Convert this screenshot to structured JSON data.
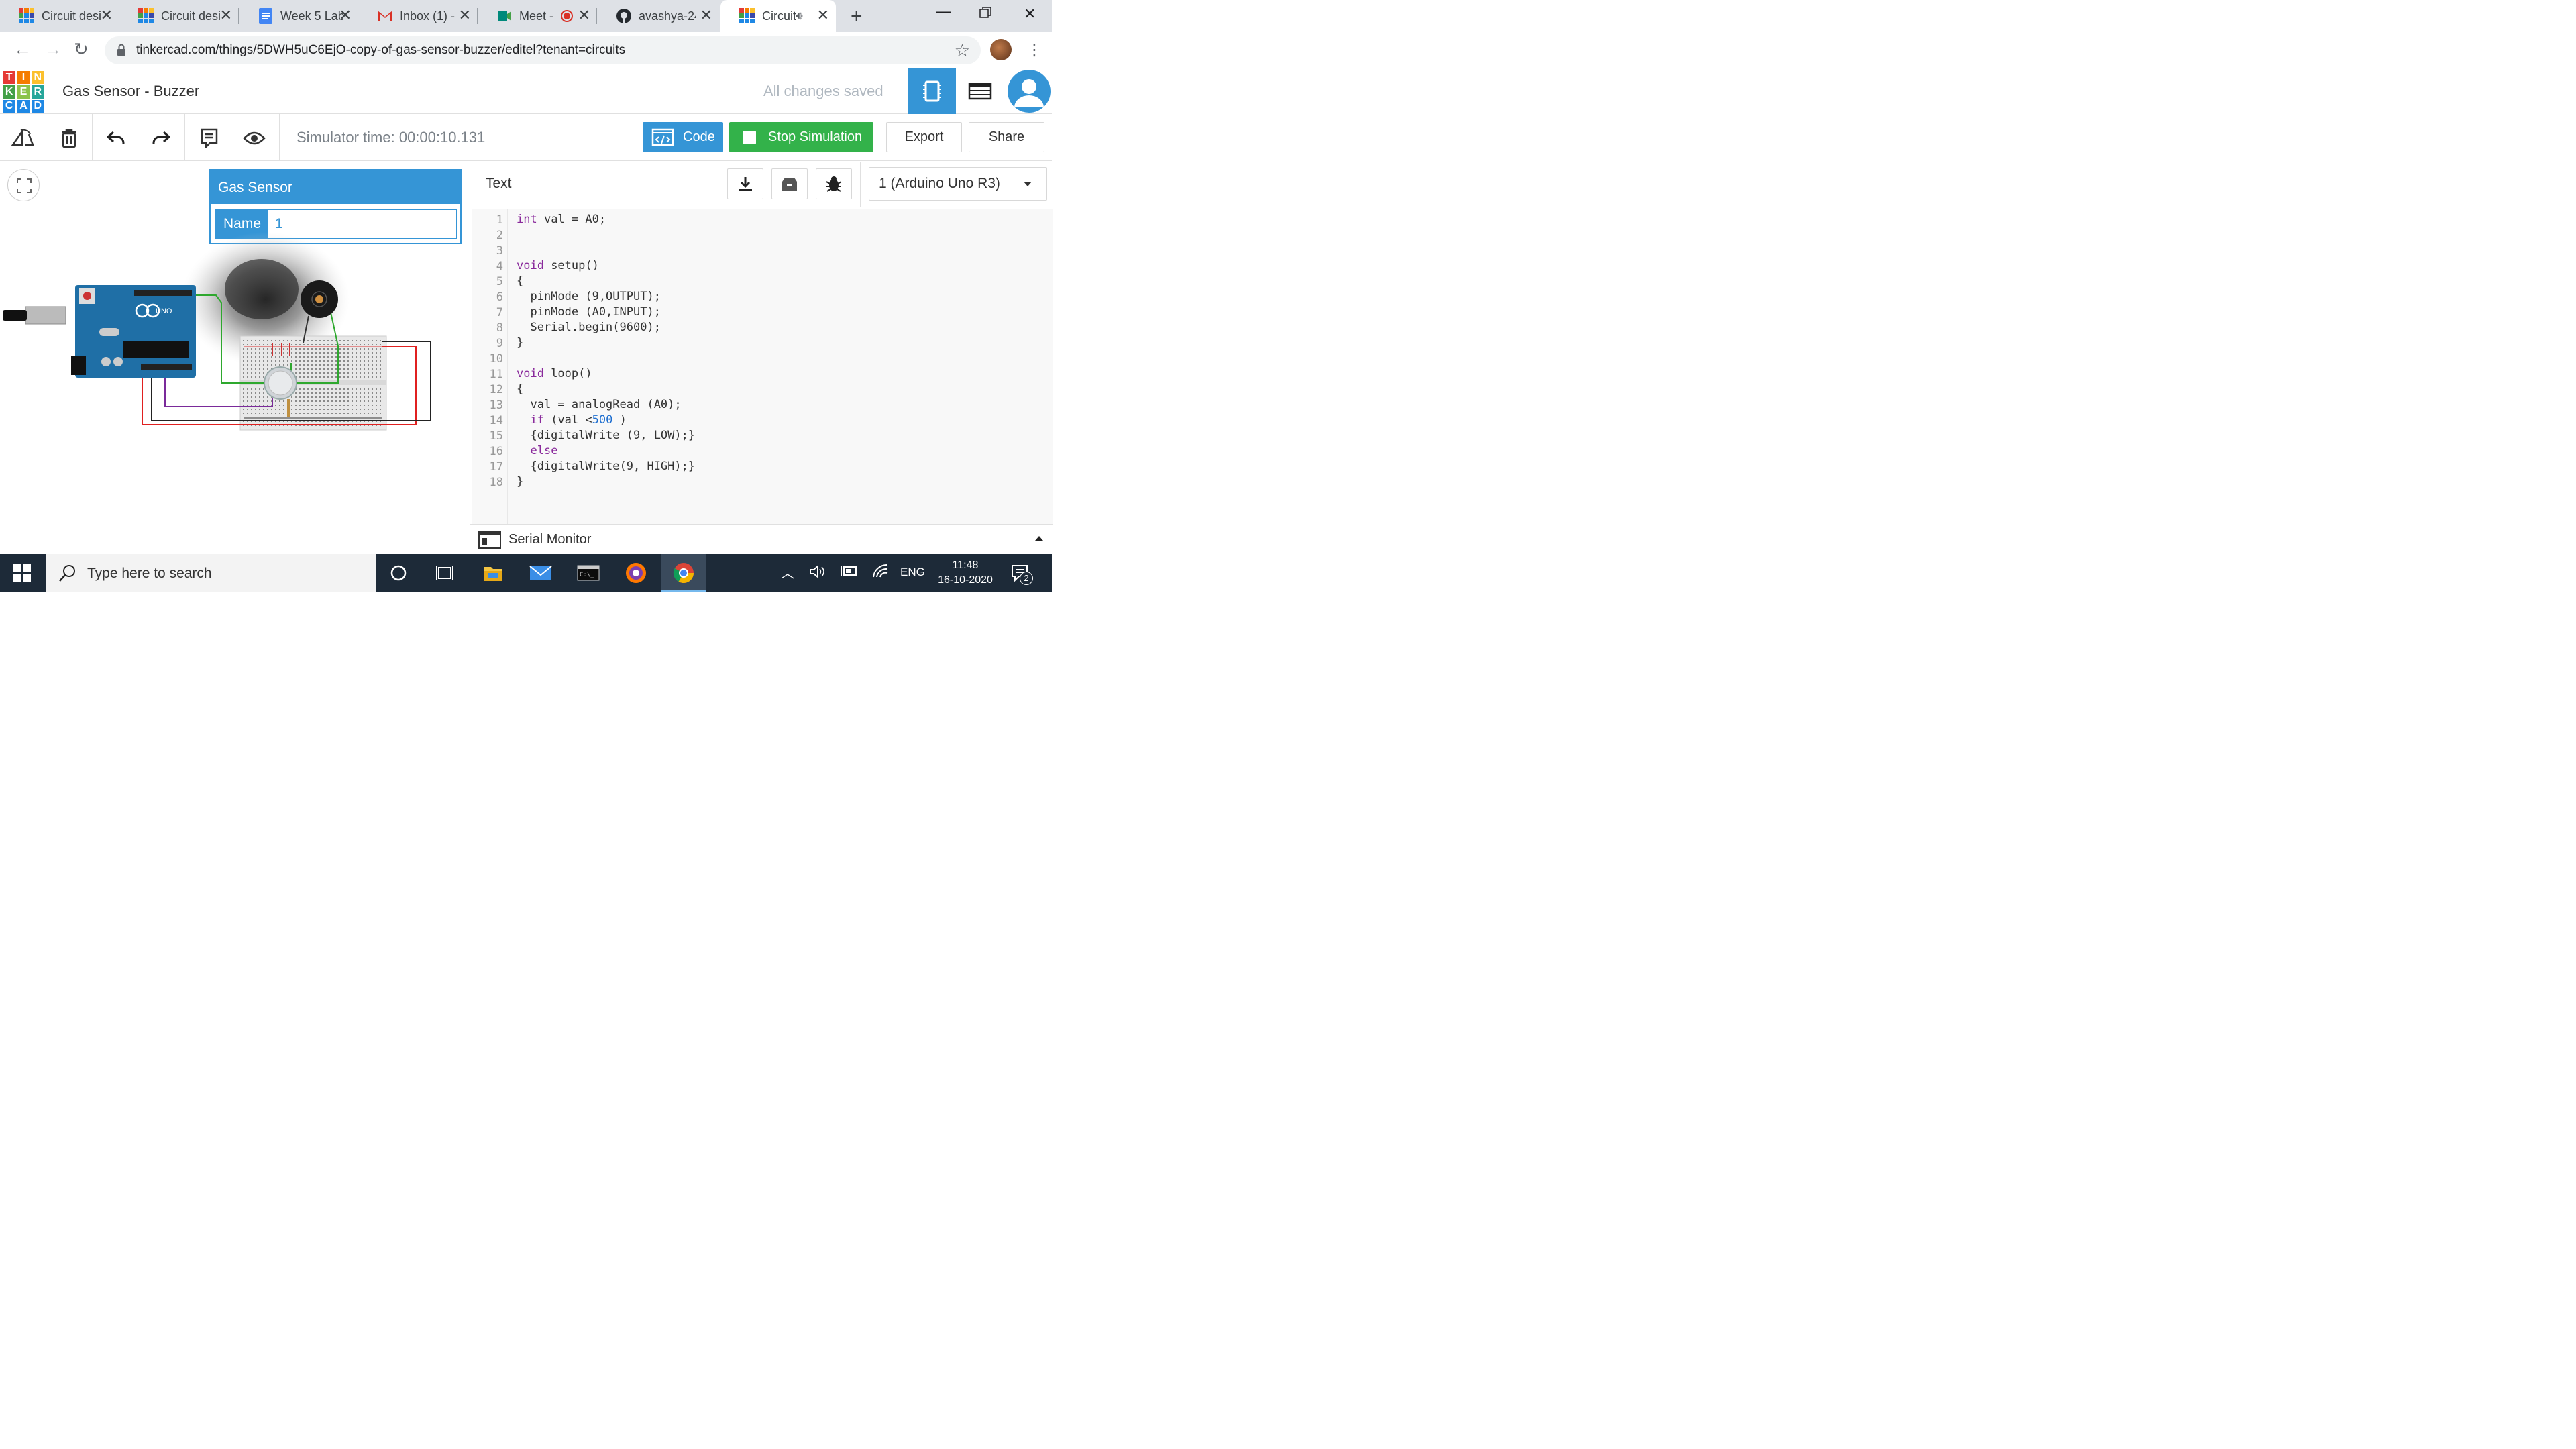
{
  "browser": {
    "tabs": [
      {
        "title": "Circuit desi",
        "icon": "tinkercad-icon"
      },
      {
        "title": "Circuit desi",
        "icon": "tinkercad-icon"
      },
      {
        "title": "Week 5 Lab",
        "icon": "docs-icon"
      },
      {
        "title": "Inbox (1) - ",
        "icon": "gmail-icon"
      },
      {
        "title": "Meet -",
        "icon": "meet-icon"
      },
      {
        "title": "avashya-24",
        "icon": "github-icon"
      },
      {
        "title": "Circuit",
        "icon": "tinkercad-icon"
      }
    ],
    "url": "tinkercad.com/things/5DWH5uC6EjO-copy-of-gas-sensor-buzzer/editel?tenant=circuits"
  },
  "app": {
    "logo_letters": [
      "T",
      "I",
      "N",
      "K",
      "E",
      "R",
      "C",
      "A",
      "D"
    ],
    "project_title": "Gas Sensor - Buzzer",
    "save_status": "All changes saved"
  },
  "toolbar": {
    "sim_time": "Simulator time: 00:00:10.131",
    "code_label": "Code",
    "stop_label": "Stop Simulation",
    "export_label": "Export",
    "share_label": "Share"
  },
  "inspector": {
    "title": "Gas Sensor",
    "name_label": "Name",
    "name_value": "1"
  },
  "code_panel": {
    "mode": "Text",
    "device": "1 (Arduino Uno R3)",
    "serial_monitor": "Serial Monitor",
    "lines": [
      "1",
      "2",
      "3",
      "4",
      "5",
      "6",
      "7",
      "8",
      "9",
      "10",
      "11",
      "12",
      "13",
      "14",
      "15",
      "16",
      "17",
      "18"
    ]
  },
  "taskbar": {
    "search_placeholder": "Type here to search",
    "language": "ENG",
    "time": "11:48",
    "date": "16-10-2020",
    "notification_count": "2"
  }
}
